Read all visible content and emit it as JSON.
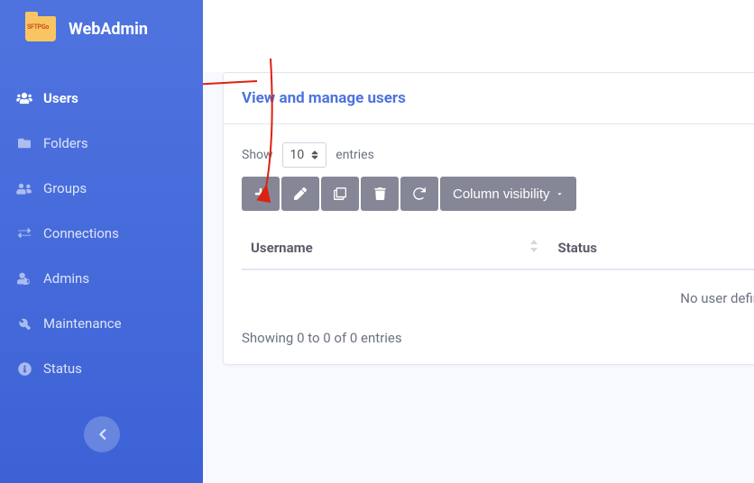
{
  "brand": {
    "logo_text": "SFTPGo",
    "title": "WebAdmin"
  },
  "sidebar": {
    "items": [
      {
        "label": "Users",
        "icon": "users-icon",
        "active": true
      },
      {
        "label": "Folders",
        "icon": "folder-icon",
        "active": false
      },
      {
        "label": "Groups",
        "icon": "groups-icon",
        "active": false
      },
      {
        "label": "Connections",
        "icon": "connections-icon",
        "active": false
      },
      {
        "label": "Admins",
        "icon": "admin-icon",
        "active": false
      },
      {
        "label": "Maintenance",
        "icon": "wrench-icon",
        "active": false
      },
      {
        "label": "Status",
        "icon": "info-icon",
        "active": false
      }
    ]
  },
  "card": {
    "title": "View and manage users",
    "entries": {
      "show_label": "Show",
      "entries_label": "entries",
      "selected": "10"
    },
    "toolbar": {
      "add_title": "Add",
      "edit_title": "Edit",
      "clone_title": "Clone",
      "delete_title": "Delete",
      "refresh_title": "Refresh",
      "colvis_label": "Column visibility"
    },
    "table": {
      "columns": [
        "Username",
        "Status"
      ],
      "empty": "No user define"
    },
    "footer": "Showing 0 to 0 of 0 entries"
  }
}
